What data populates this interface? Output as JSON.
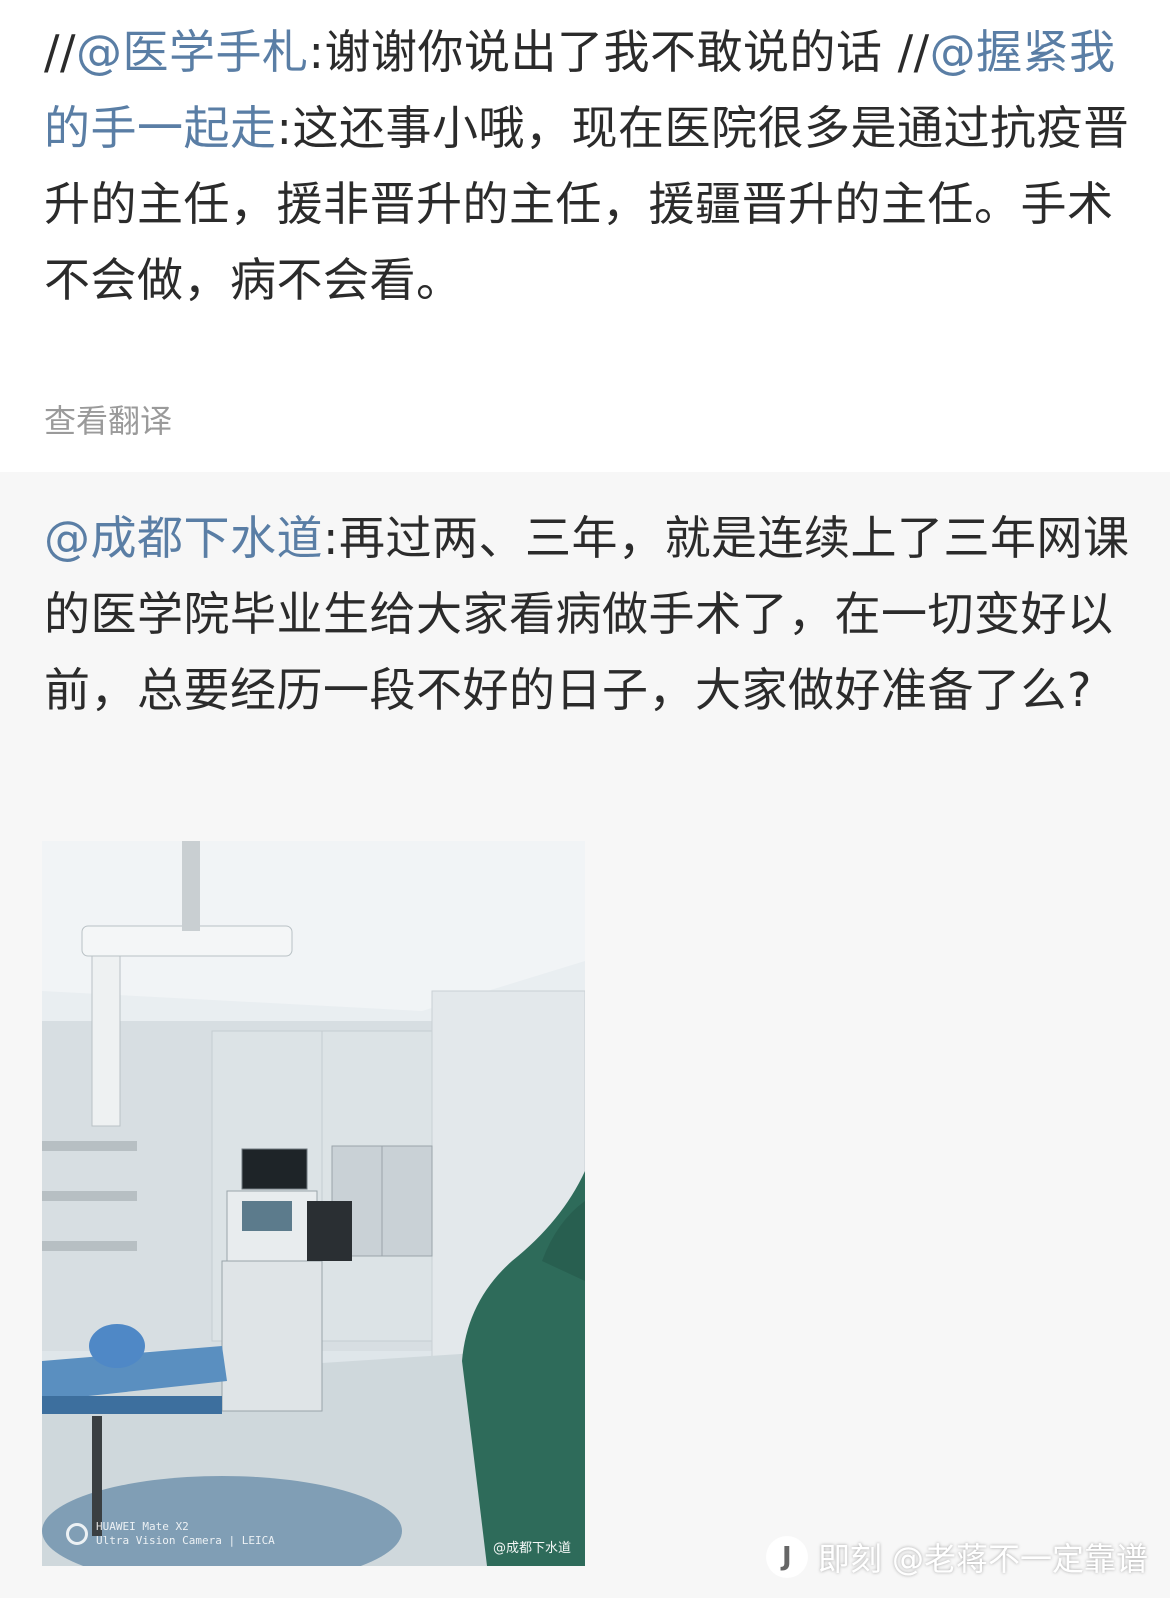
{
  "repost": {
    "prefix1": "//",
    "user1": "@医学手札",
    "text1": ":谢谢你说出了我不敢说的话",
    "prefix2": " //",
    "user2": "@握紧我的手一起走",
    "text2": ":这还事小哦，现在医院很多是通过抗疫晋升的主任，援非晋升的主任，援疆晋升的主任。手术不会做，病不会看。",
    "translate_label": "查看翻译"
  },
  "original": {
    "user": "@成都下水道",
    "text": ":再过两、三年，就是连续上了三年网课的医学院毕业生给大家看病做手术了，在一切变好以前，总要经历一段不好的日子，大家做好准备了么?"
  },
  "photo": {
    "camera_line1": "HUAWEI Mate X2",
    "camera_line2": "Ultra Vision Camera | LEICA",
    "watermark": "@成都下水道"
  },
  "site_watermark": {
    "logo": "J",
    "text": "即刻 @老蒋不一定靠谱"
  },
  "colors": {
    "mention": "#5a7ea5",
    "text": "#2b2b2b",
    "muted": "#9a9a9a",
    "card_bg": "#f7f7f7",
    "scrubs": "#2e6b5a"
  }
}
